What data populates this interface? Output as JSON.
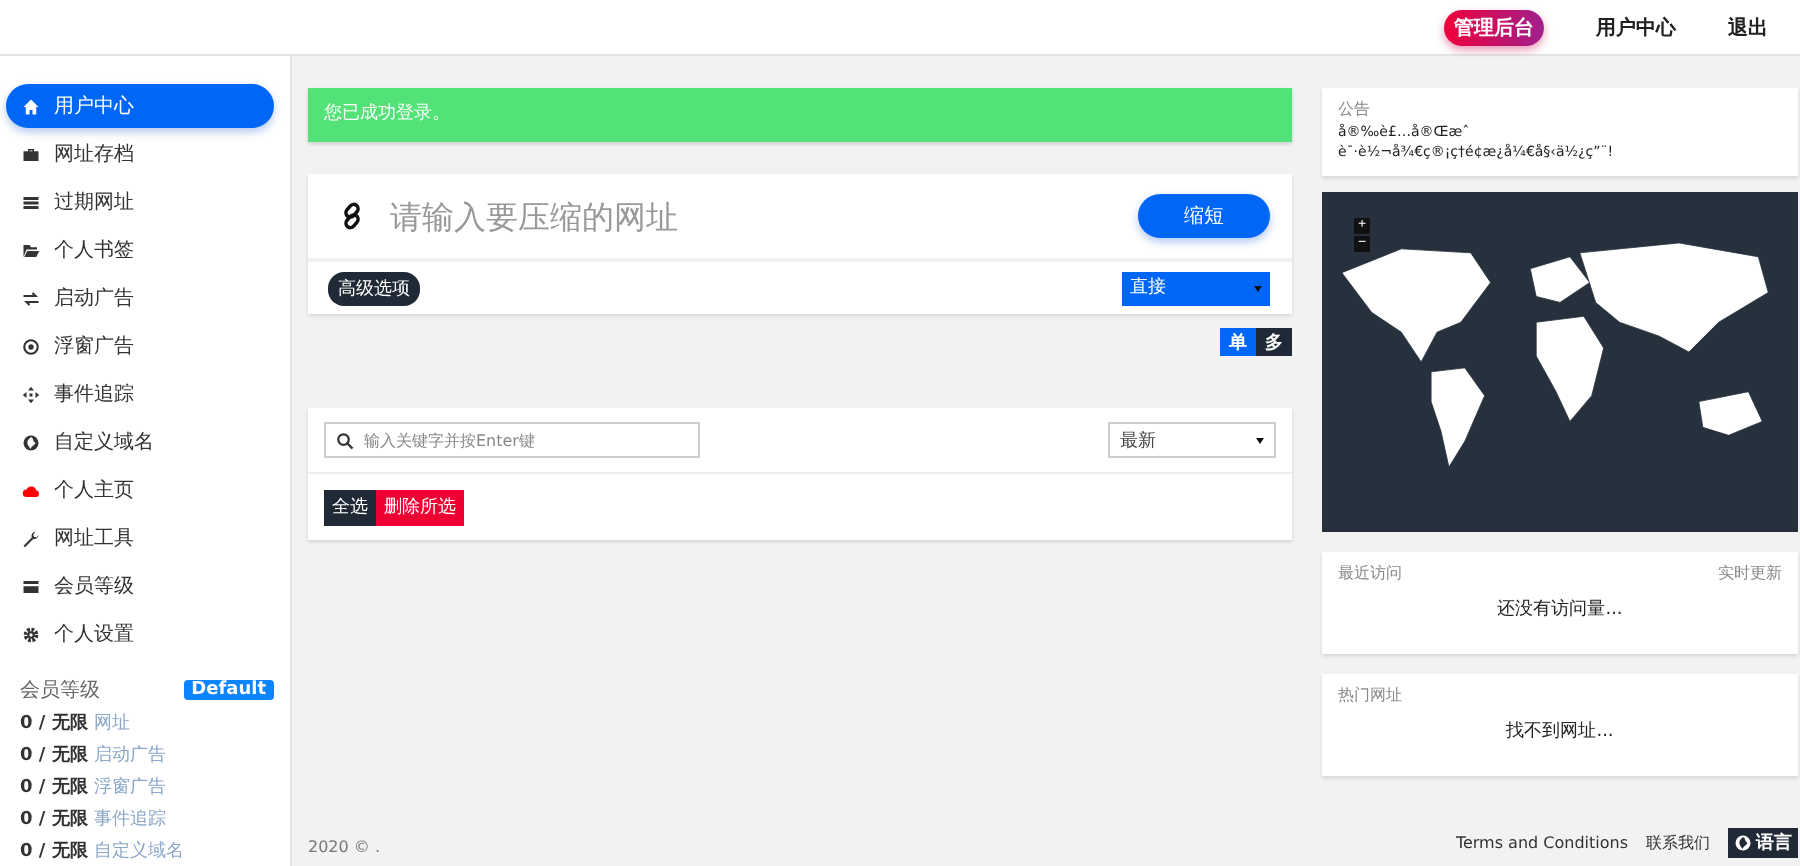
{
  "top_nav": {
    "admin_badge": "管理后台",
    "links": [
      {
        "label": "用户中心"
      },
      {
        "label": "退出"
      }
    ]
  },
  "sidebar": {
    "items": [
      {
        "label": "用户中心",
        "selected": true
      },
      {
        "label": "网址存档",
        "selected": false
      },
      {
        "label": "过期网址",
        "selected": false
      },
      {
        "label": "个人书签",
        "selected": false
      },
      {
        "label": "启动广告",
        "selected": false
      },
      {
        "label": "浮窗广告",
        "selected": false
      },
      {
        "label": "事件追踪",
        "selected": false
      },
      {
        "label": "自定义域名",
        "selected": false
      },
      {
        "label": "个人主页",
        "selected": false
      },
      {
        "label": "网址工具",
        "selected": false
      },
      {
        "label": "会员等级",
        "selected": false
      },
      {
        "label": "个人设置",
        "selected": false
      }
    ],
    "plan": {
      "title": "会员等级",
      "badge": "Default",
      "limits": [
        {
          "count": "0 / 无限",
          "label": "网址"
        },
        {
          "count": "0 / 无限",
          "label": "启动广告"
        },
        {
          "count": "0 / 无限",
          "label": "浮窗广告"
        },
        {
          "count": "0 / 无限",
          "label": "事件追踪"
        },
        {
          "count": "0 / 无限",
          "label": "自定义域名"
        }
      ]
    }
  },
  "alert": "您已成功登录。",
  "shorten": {
    "placeholder": "请输入要压缩的网址",
    "button": "缩短",
    "advanced": "高级选项",
    "redirect": "直接",
    "modes": [
      {
        "label": "单",
        "selected": true
      },
      {
        "label": "多",
        "selected": false
      }
    ]
  },
  "links_panel": {
    "search_placeholder": "输入关键字并按Enter键",
    "sort": "最新",
    "select_all": "全选",
    "delete_selected": "删除所选"
  },
  "footer": {
    "copyright": "2020 © .",
    "terms": "Terms and Conditions",
    "contact": "联系我们",
    "language": "语言"
  },
  "notice": {
    "title": "公告",
    "lines": [
      "å®‰è£…å®Œæˆ",
      "è¯·è½¬å¾€ç®¡ç†é¢æ¿å¼€å§‹ä½¿ç”¨!"
    ]
  },
  "map": {
    "zoom_in": "+",
    "zoom_out": "−"
  },
  "recent": {
    "title": "最近访问",
    "live": "实时更新",
    "empty": "还没有访问量..."
  },
  "popular": {
    "title": "热门网址",
    "empty": "找不到网址..."
  }
}
